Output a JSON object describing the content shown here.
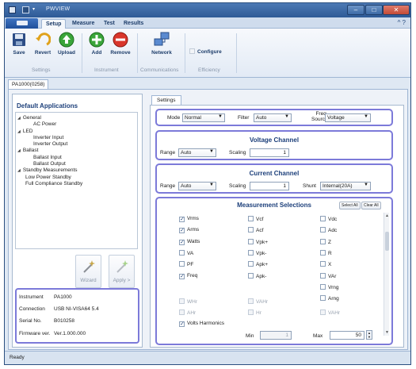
{
  "app": {
    "title": "PWVIEW"
  },
  "ribbon_tabs": [
    "Setup",
    "Measure",
    "Test",
    "Results"
  ],
  "ribbon": {
    "buttons": [
      {
        "label": "Save",
        "icon": "floppy-disk-icon"
      },
      {
        "label": "Revert",
        "icon": "revert-arrow-icon"
      },
      {
        "label": "Upload",
        "icon": "green-up-arrow-icon"
      },
      {
        "label": "Add",
        "icon": "green-plus-icon"
      },
      {
        "label": "Remove",
        "icon": "red-minus-icon"
      },
      {
        "label": "Network",
        "icon": "network-icon"
      }
    ],
    "configure_label": "Configure",
    "groups": [
      "Settings",
      "Instrument",
      "Communications",
      "Efficiency"
    ]
  },
  "document_tab": "PA1000(0258)",
  "left": {
    "title": "Default Applications",
    "tree": [
      {
        "text": "General",
        "level": 0
      },
      {
        "text": "AC Power",
        "level": 2
      },
      {
        "text": "LED",
        "level": 0
      },
      {
        "text": "Inverter Input",
        "level": 2
      },
      {
        "text": "Inverter Output",
        "level": 2
      },
      {
        "text": "Ballast",
        "level": 0
      },
      {
        "text": "Ballast Input",
        "level": 2
      },
      {
        "text": "Ballast Output",
        "level": 2
      },
      {
        "text": "Standby Measurements",
        "level": 0
      },
      {
        "text": "Low Power Standby",
        "level": 1
      },
      {
        "text": "Full Compliance Standby",
        "level": 1
      }
    ],
    "wizard_label": "Wizard",
    "apply_label": "Apply >",
    "info": {
      "instrument_label": "Instrument",
      "instrument": "PA1000",
      "connection_label": "Connection",
      "connection": "USB NI-VISA64 5.4",
      "serial_label": "Serial No.",
      "serial": "B010258",
      "firmware_label": "Firmware ver.",
      "firmware": "Ver.1.000.000"
    }
  },
  "settings": {
    "tab_label": "Settings",
    "mode_label": "Mode",
    "mode": "Normal",
    "filter_label": "Filter",
    "filter": "Auto",
    "freq_label_1": "Freq.",
    "freq_label_2": "Source",
    "freq_source": "Voltage",
    "voltage": {
      "title": "Voltage Channel",
      "range_label": "Range",
      "range": "Auto",
      "scaling_label": "Scaling",
      "scaling": "1"
    },
    "current": {
      "title": "Current Channel",
      "range_label": "Range",
      "range": "Auto",
      "scaling_label": "Scaling",
      "scaling": "1",
      "shunt_label": "Shunt",
      "shunt": "Internal(20A)"
    },
    "measurements": {
      "title": "Measurement Selections",
      "select_all": "Select All",
      "clear_all": "Clear All",
      "col1": [
        {
          "label": "Vrms",
          "checked": true
        },
        {
          "label": "Arms",
          "checked": true
        },
        {
          "label": "Watts",
          "checked": true
        },
        {
          "label": "VA",
          "checked": false
        },
        {
          "label": "PF",
          "checked": false
        },
        {
          "label": "Freq",
          "checked": true
        }
      ],
      "col2": [
        {
          "label": "Vcf",
          "checked": false
        },
        {
          "label": "Acf",
          "checked": false
        },
        {
          "label": "Vpk+",
          "checked": false
        },
        {
          "label": "Vpk-",
          "checked": false
        },
        {
          "label": "Apk+",
          "checked": false
        },
        {
          "label": "Apk-",
          "checked": false
        }
      ],
      "col3": [
        {
          "label": "Vdc",
          "checked": false
        },
        {
          "label": "Adc",
          "checked": false
        },
        {
          "label": "Z",
          "checked": false
        },
        {
          "label": "R",
          "checked": false
        },
        {
          "label": "X",
          "checked": false
        },
        {
          "label": "VAr",
          "checked": false
        },
        {
          "label": "Vrng",
          "checked": false
        },
        {
          "label": "Arng",
          "checked": false
        }
      ],
      "integrator": [
        {
          "label": "WHr"
        },
        {
          "label": "VAHr"
        },
        {
          "label": "AHr"
        },
        {
          "label": "Hr"
        },
        {
          "label": "VAHr"
        }
      ],
      "volts_harmonics": "Volts Harmonics",
      "min_label": "Min",
      "min": "1",
      "max_label": "Max",
      "max": "50"
    }
  },
  "status": "Ready"
}
